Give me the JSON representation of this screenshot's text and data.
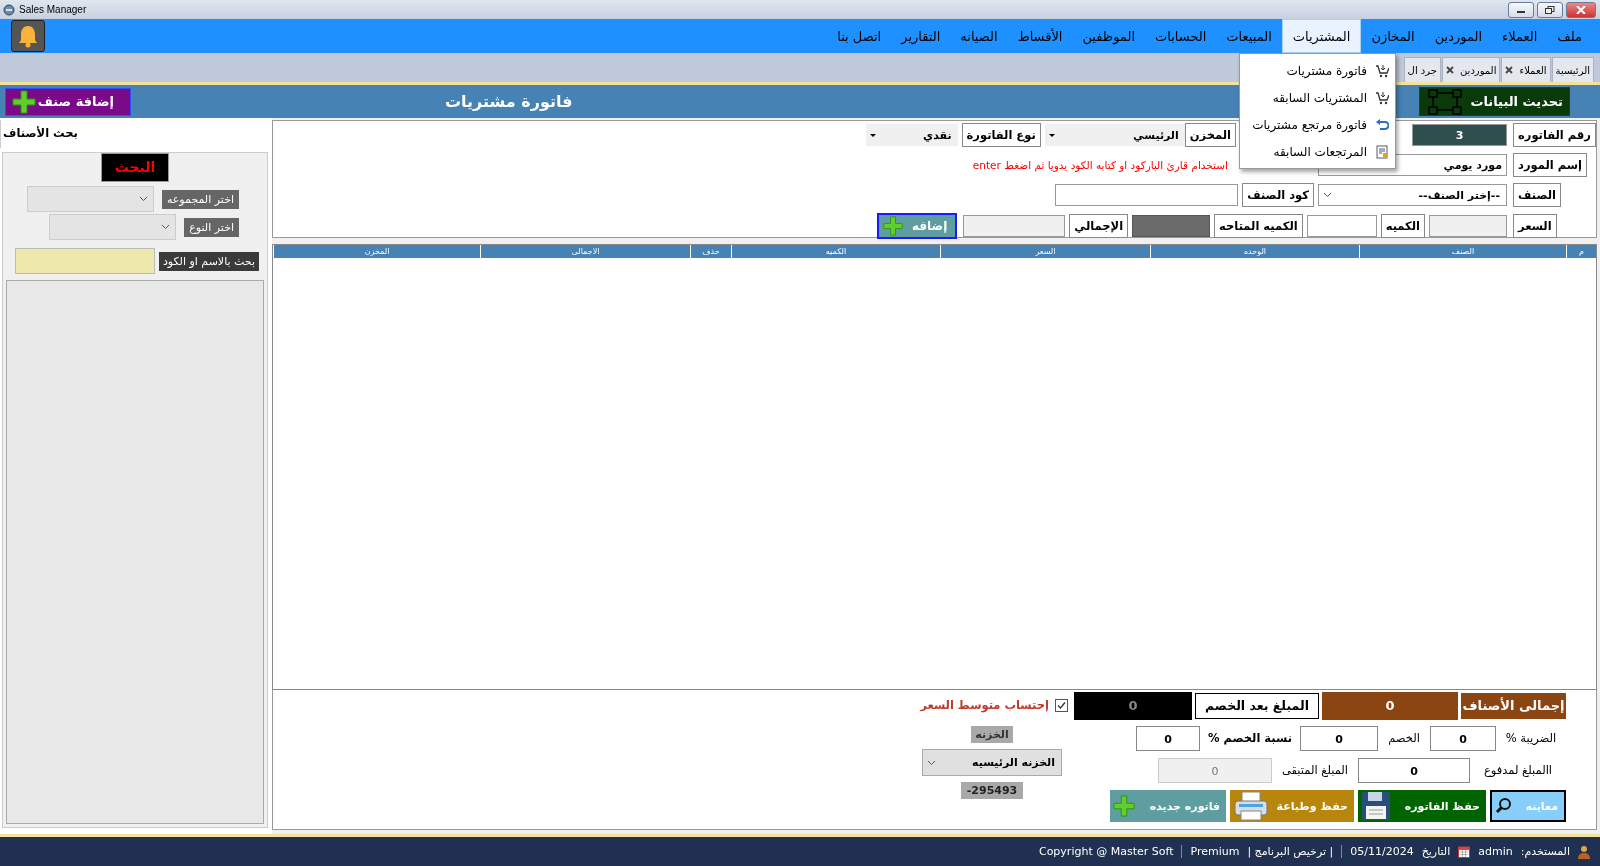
{
  "window": {
    "title": "Sales Manager"
  },
  "menu": [
    {
      "label": "ملف",
      "selected": false
    },
    {
      "label": "العملاء",
      "selected": false
    },
    {
      "label": "الموردين",
      "selected": false
    },
    {
      "label": "المخازن",
      "selected": false
    },
    {
      "label": "المشتريات",
      "selected": true
    },
    {
      "label": "المبيعات",
      "selected": false
    },
    {
      "label": "الحسابات",
      "selected": false
    },
    {
      "label": "الموظفين",
      "selected": false
    },
    {
      "label": "الأقساط",
      "selected": false
    },
    {
      "label": "الصيانه",
      "selected": false
    },
    {
      "label": "التقارير",
      "selected": false
    },
    {
      "label": "اتصل بنا",
      "selected": false
    }
  ],
  "submenu": [
    {
      "label": "فاتورة مشتريات",
      "kind": "cart"
    },
    {
      "label": "المشتريات السابقه",
      "kind": "cart"
    },
    {
      "label": "فاتورة مرتجع مشتريات",
      "kind": "return"
    },
    {
      "label": "المرتجعات السابقه",
      "kind": "report"
    }
  ],
  "tabs": [
    {
      "label": "الرئيسية",
      "closable": false,
      "selected": false
    },
    {
      "label": "العملاء",
      "closable": true,
      "selected": false
    },
    {
      "label": "الموردين",
      "closable": true,
      "selected": false
    },
    {
      "label": "جرد ال",
      "closable": false,
      "selected": false
    }
  ],
  "header": {
    "refresh_button": "تحديث البيانات",
    "title": "فاتورة مشتريات",
    "add_item_button": "إضافة صنف"
  },
  "search_panel": {
    "tab": "بحث الأصناف",
    "heading": "البحث",
    "group_label": "اختر المجموعه",
    "type_label": "اختر النوع",
    "search_label": "بحث بالاسم او الكود"
  },
  "form": {
    "invoice_no_label": "رقم الفاتوره",
    "invoice_no": "3",
    "store_label": "المخزن",
    "store": "الرئيسي",
    "invoice_type_label": "نوع الفاتورة",
    "invoice_type": "نقدي",
    "supplier_label": "إسم المورد",
    "supplier": "مورد يومي",
    "barcode_hint": "استخدام قارئ الباركود او كتابه الكود يدويا ثم اضغط enter",
    "item_label": "الصنف",
    "item": "--إختر الصنف--",
    "item_code_label": "كود الصنف",
    "price_label": "السعر",
    "qty_label": "الكميه",
    "available_label": "الكميه المتاحه",
    "total_label": "الإجمالي",
    "add_button": "إضافه"
  },
  "table": {
    "columns": [
      "م",
      "الصنف",
      "الوحده",
      "السعر",
      "الكميه",
      "حذف",
      "الاجمالى",
      "المخزن"
    ]
  },
  "summary": {
    "items_total_label": "إجمالى الأصناف",
    "items_total": "0",
    "after_discount_label": "المبلغ بعد الخصم",
    "after_discount": "0",
    "average_price": {
      "label": "إحتساب متوسط السعر",
      "checked": true
    },
    "tax_label": "الضريبة %",
    "tax": "0",
    "discount_label": "الخصم",
    "discount": "0",
    "discount_pct_label": "نسبة الخصم %",
    "discount_pct": "0",
    "paid_label": "االمبلغ لمدفوع",
    "paid": "0",
    "remaining_label": "المبلغ المتبقى",
    "remaining": "0",
    "safe_label": "الخزنه",
    "safe": "الخزنه الرئيسيه",
    "safe_balance": "295493-",
    "preview_button": "معاينه",
    "save_button": "حفظ الفاتوره",
    "save_print_button": "حفظ وطباعة",
    "new_button": "فاتوره جديده"
  },
  "status_bar": {
    "user_label": "المستخدم:",
    "user": "admin",
    "date_label": "التاريخ",
    "date": "05/11/2024",
    "license": "| ترخيص البرنامج |",
    "edition": "Premium",
    "copyright": "Copyright @ Master Soft"
  }
}
